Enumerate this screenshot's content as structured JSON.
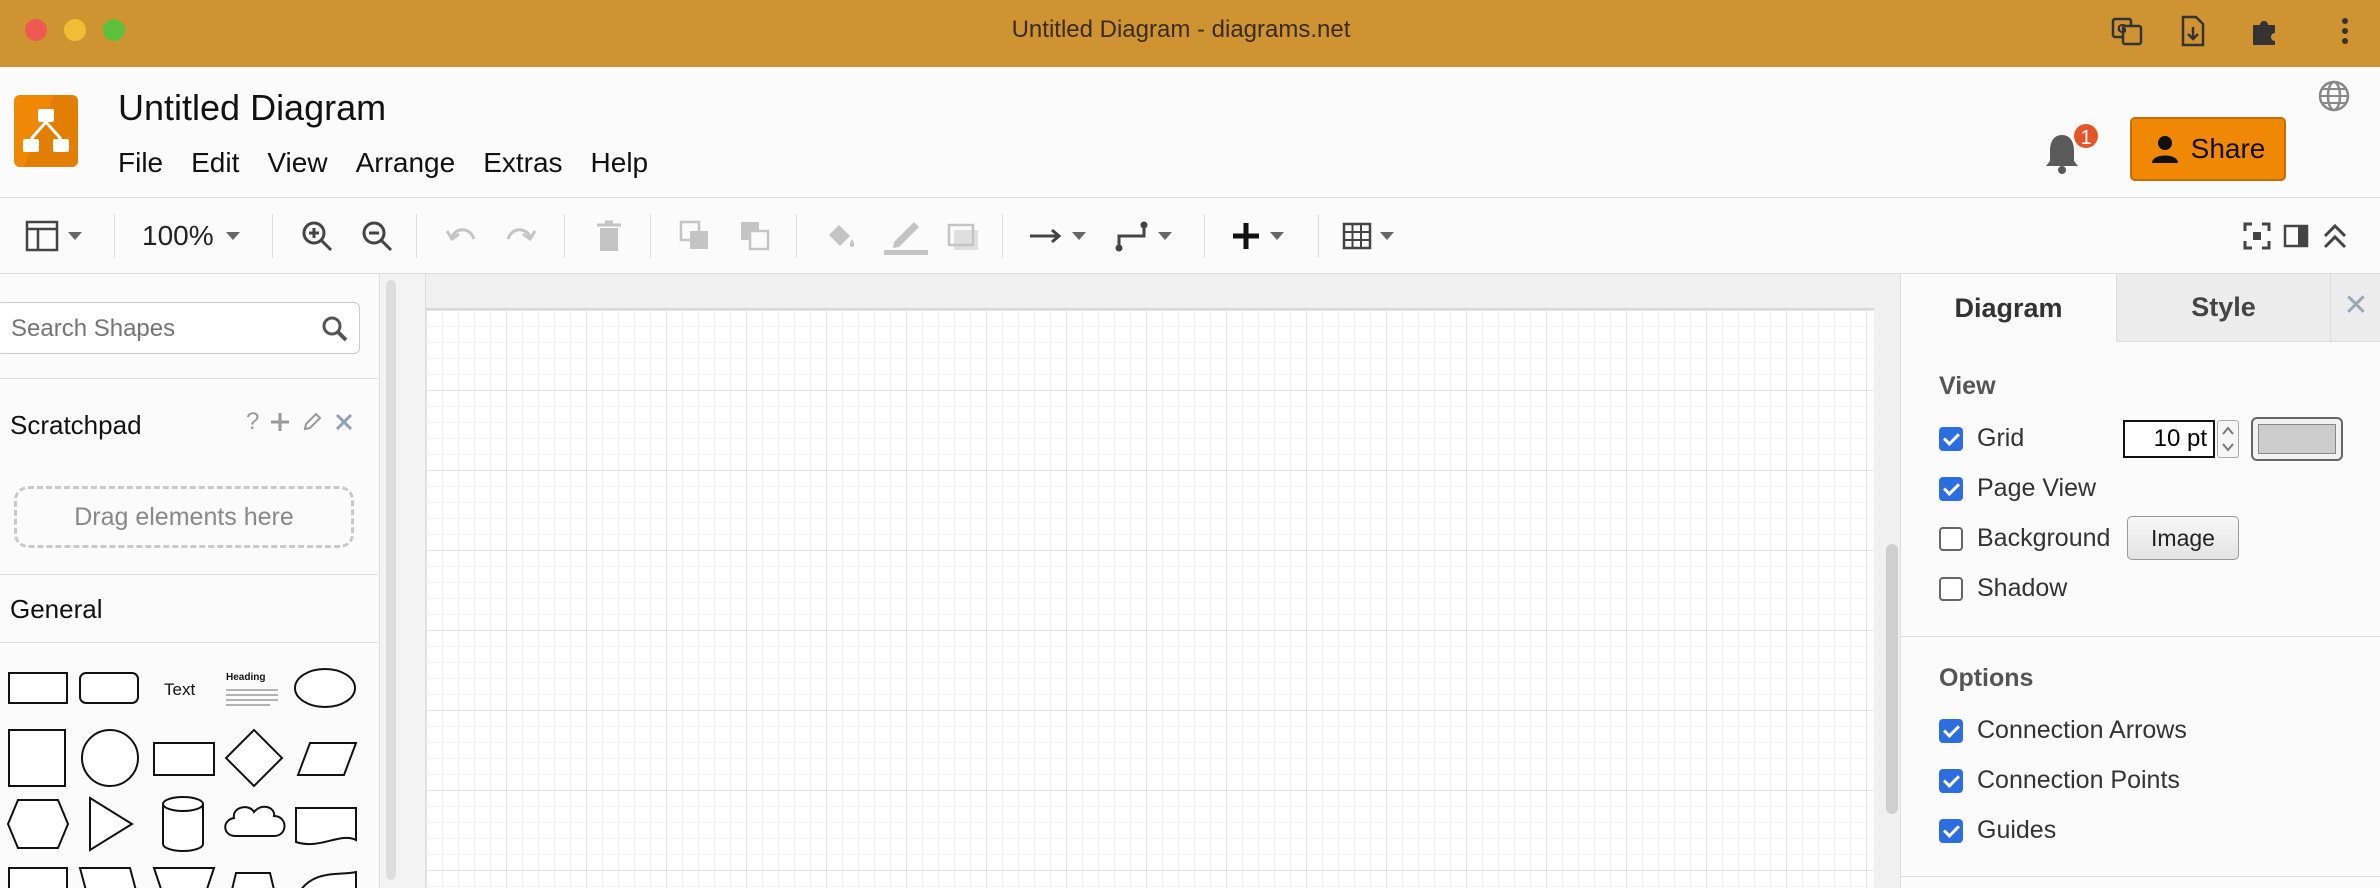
{
  "window": {
    "title": "Untitled Diagram - diagrams.net"
  },
  "header": {
    "doc_title": "Untitled Diagram",
    "menu": [
      "File",
      "Edit",
      "View",
      "Arrange",
      "Extras",
      "Help"
    ],
    "notification_count": "1",
    "share_label": "Share"
  },
  "toolbar": {
    "zoom": "100%"
  },
  "sidebar": {
    "search_placeholder": "Search Shapes",
    "scratchpad_title": "Scratchpad",
    "scratchpad_help": "?",
    "dropzone_label": "Drag elements here",
    "general_title": "General",
    "shape_text": "Text",
    "shape_heading": "Heading"
  },
  "panel": {
    "tabs": [
      "Diagram",
      "Style"
    ],
    "view_heading": "View",
    "grid_label": "Grid",
    "grid_size": "10 pt",
    "page_view_label": "Page View",
    "background_label": "Background",
    "image_button": "Image",
    "shadow_label": "Shadow",
    "options_heading": "Options",
    "connection_arrows_label": "Connection Arrows",
    "connection_points_label": "Connection Points",
    "guides_label": "Guides",
    "checks": {
      "grid": true,
      "page_view": true,
      "background": false,
      "shadow": false,
      "connection_arrows": true,
      "connection_points": true,
      "guides": true
    }
  },
  "colors": {
    "titlebar": "#cf9431",
    "accent": "#f08705",
    "checkbox": "#2c6ee0",
    "grid_color": "#cccccc"
  }
}
